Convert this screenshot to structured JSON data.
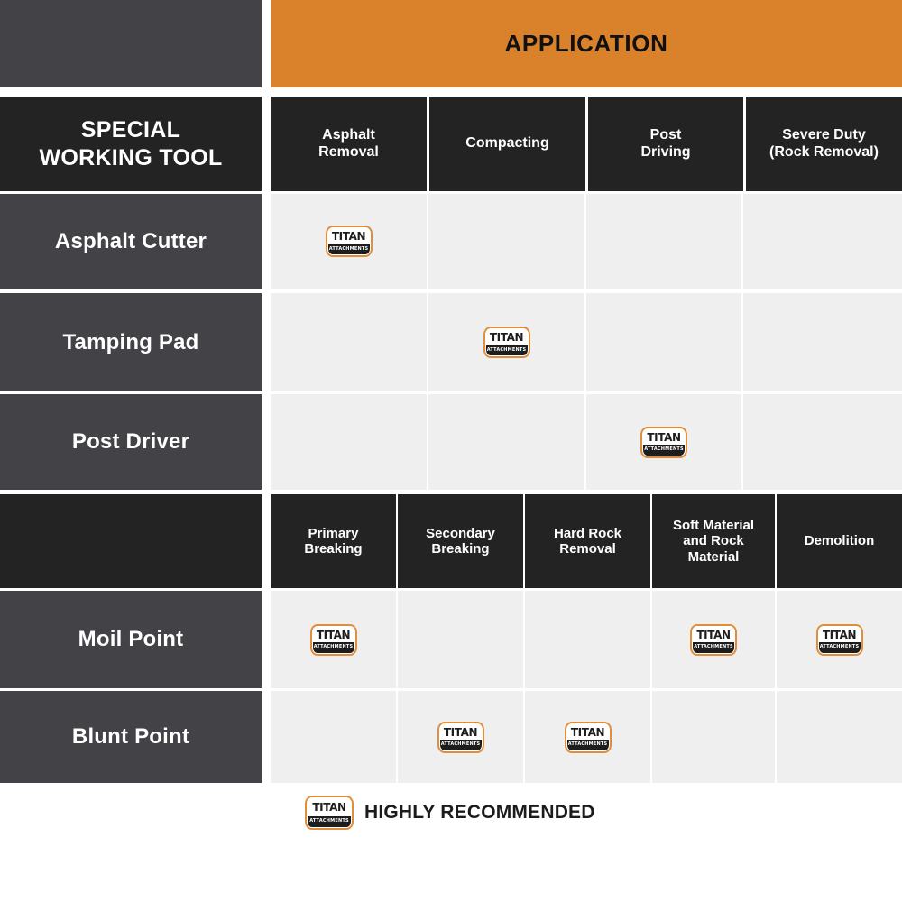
{
  "banner": {
    "title": "APPLICATION",
    "orange": "#d9822b"
  },
  "section1": {
    "row_header_label": "SPECIAL\nWORKING TOOL",
    "row_header_line1": "SPECIAL",
    "row_header_line2": "WORKING TOOL",
    "columns": [
      {
        "line1": "Asphalt",
        "line2": "Removal"
      },
      {
        "line1": "Compacting",
        "line2": ""
      },
      {
        "line1": "Post",
        "line2": "Driving"
      },
      {
        "line1": "Severe Duty",
        "line2": "(Rock Removal)"
      }
    ],
    "rows": [
      {
        "tool": "Asphalt Cutter",
        "marks": [
          true,
          false,
          false,
          false
        ]
      },
      {
        "tool": "Tamping Pad",
        "marks": [
          false,
          true,
          false,
          false
        ]
      },
      {
        "tool": "Post Driver",
        "marks": [
          false,
          false,
          true,
          false
        ]
      }
    ]
  },
  "section2": {
    "row_header_label": "",
    "columns": [
      {
        "line1": "Primary",
        "line2": "Breaking",
        "line3": ""
      },
      {
        "line1": "Secondary",
        "line2": "Breaking",
        "line3": ""
      },
      {
        "line1": "Hard Rock",
        "line2": "Removal",
        "line3": ""
      },
      {
        "line1": "Soft Material",
        "line2": "and Rock",
        "line3": "Material"
      },
      {
        "line1": "Demolition",
        "line2": "",
        "line3": ""
      }
    ],
    "rows": [
      {
        "tool": "Moil Point",
        "marks": [
          true,
          false,
          false,
          true,
          true
        ]
      },
      {
        "tool": "Blunt Point",
        "marks": [
          false,
          true,
          true,
          false,
          false
        ]
      }
    ]
  },
  "legend": {
    "text": "HIGHLY RECOMMENDED",
    "icon": "titan-attachments-logo"
  },
  "logo": {
    "word": "TITAN",
    "sub": "ATTACHMENTS"
  },
  "colors": {
    "accent_orange": "#d9822b",
    "header_dark": "#232323",
    "label_gray": "#424247",
    "cell_gray": "#efefef",
    "page_white": "#ffffff"
  }
}
